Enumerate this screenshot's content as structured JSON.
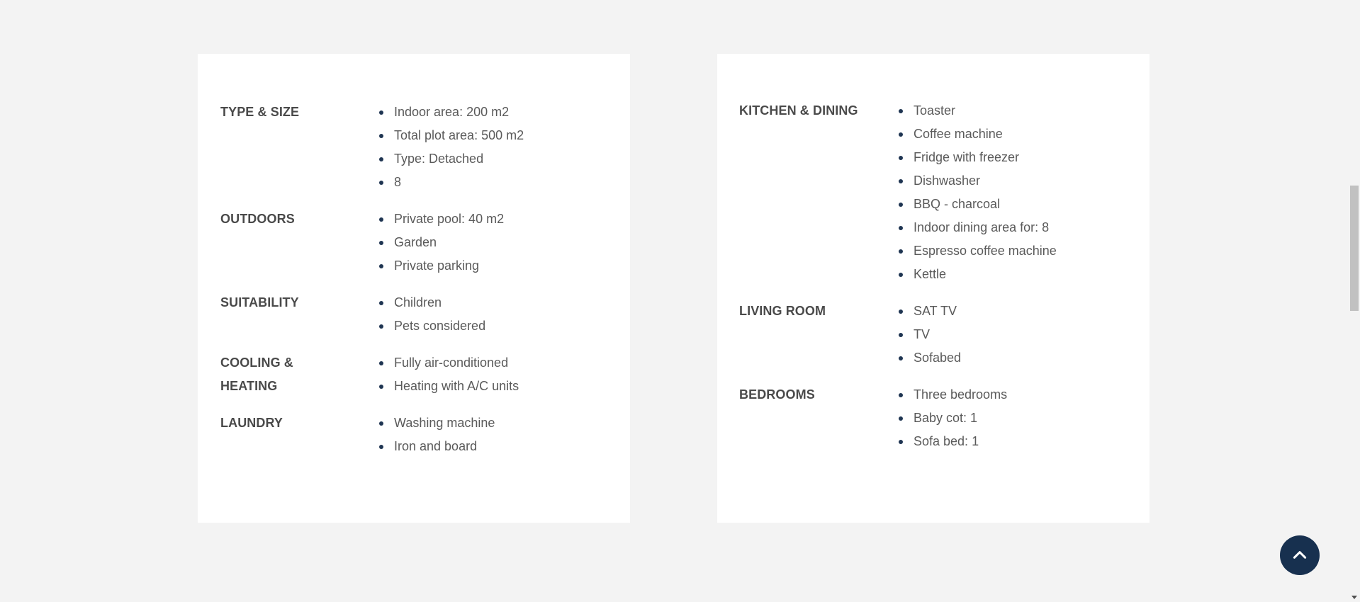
{
  "left_card": {
    "groups": [
      {
        "title": "TYPE & SIZE",
        "items": [
          "Indoor area: 200 m2",
          "Total plot area: 500 m2",
          "Type: Detached",
          "8"
        ]
      },
      {
        "title": "OUTDOORS",
        "items": [
          "Private pool: 40 m2",
          "Garden",
          "Private parking"
        ]
      },
      {
        "title": "SUITABILITY",
        "items": [
          "Children",
          "Pets considered"
        ]
      },
      {
        "title": "COOLING & HEATING",
        "items": [
          "Fully air-conditioned",
          "Heating with A/C units"
        ]
      },
      {
        "title": "LAUNDRY",
        "items": [
          "Washing machine",
          "Iron and board"
        ]
      }
    ]
  },
  "right_card": {
    "groups": [
      {
        "title": "KITCHEN & DINING",
        "items": [
          "Toaster",
          "Coffee machine",
          "Fridge with freezer",
          "Dishwasher",
          "BBQ - charcoal",
          "Indoor dining area for: 8",
          "Espresso coffee machine",
          "Kettle"
        ]
      },
      {
        "title": "LIVING ROOM",
        "items": [
          "SAT TV",
          "TV",
          "Sofabed"
        ]
      },
      {
        "title": "BEDROOMS",
        "items": [
          "Three bedrooms",
          "Baby cot: 1",
          "Sofa bed: 1"
        ]
      }
    ]
  },
  "back_to_top": {
    "icon": "chevron-up-icon"
  },
  "colors": {
    "background": "#f3f3f3",
    "card": "#ffffff",
    "bullet": "#1f3552",
    "back_to_top_button": "#17304f"
  }
}
